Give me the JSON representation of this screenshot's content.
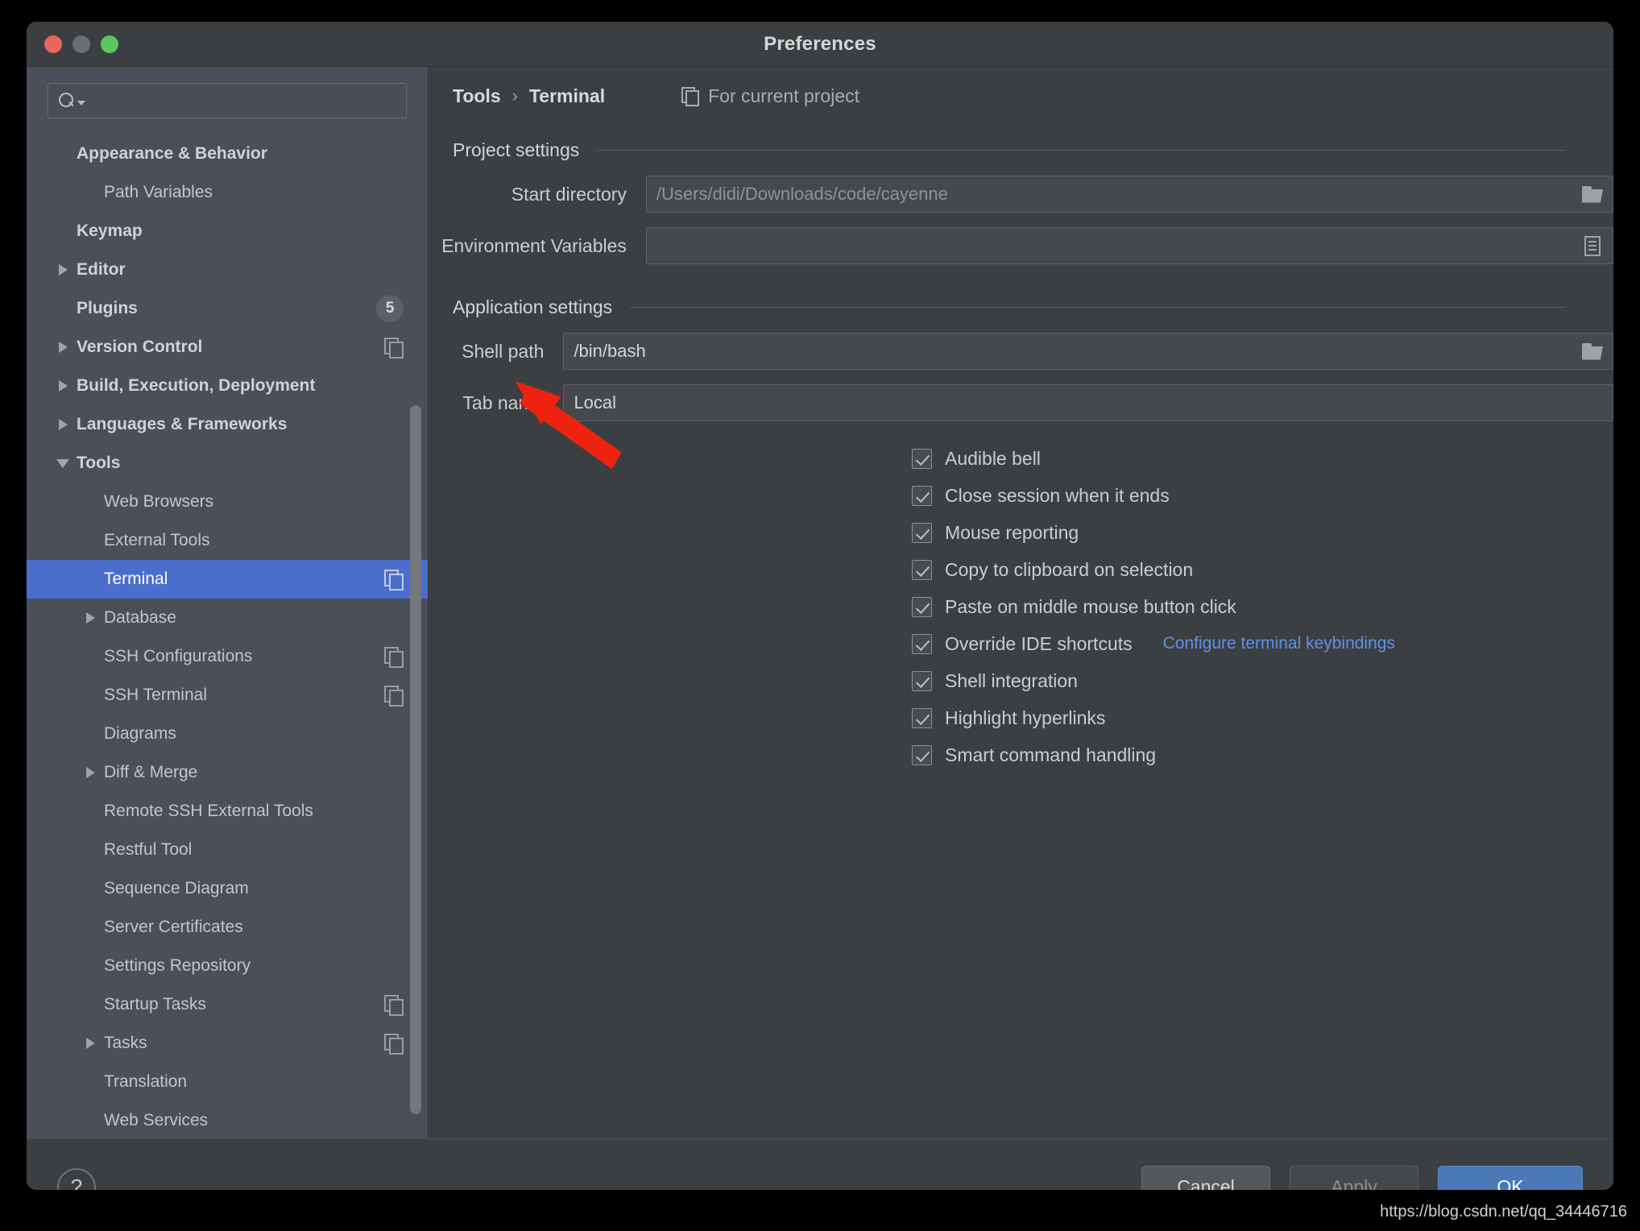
{
  "window": {
    "title": "Preferences",
    "traffic_lights": [
      "close",
      "minimize",
      "zoom"
    ]
  },
  "sidebar": {
    "search": {
      "value": "",
      "placeholder": ""
    },
    "items": [
      {
        "label": "Appearance & Behavior",
        "indent": 0,
        "bold": true,
        "arrow": "none"
      },
      {
        "label": "Path Variables",
        "indent": 1,
        "bold": false,
        "arrow": "none"
      },
      {
        "label": "Keymap",
        "indent": 0,
        "bold": true,
        "arrow": "none"
      },
      {
        "label": "Editor",
        "indent": 0,
        "bold": true,
        "arrow": "collapsed"
      },
      {
        "label": "Plugins",
        "indent": 0,
        "bold": true,
        "arrow": "none",
        "badge": "5"
      },
      {
        "label": "Version Control",
        "indent": 0,
        "bold": true,
        "arrow": "collapsed",
        "copy": true
      },
      {
        "label": "Build, Execution, Deployment",
        "indent": 0,
        "bold": true,
        "arrow": "collapsed"
      },
      {
        "label": "Languages & Frameworks",
        "indent": 0,
        "bold": true,
        "arrow": "collapsed"
      },
      {
        "label": "Tools",
        "indent": 0,
        "bold": true,
        "arrow": "expanded"
      },
      {
        "label": "Web Browsers",
        "indent": 1,
        "bold": false,
        "arrow": "none"
      },
      {
        "label": "External Tools",
        "indent": 1,
        "bold": false,
        "arrow": "none"
      },
      {
        "label": "Terminal",
        "indent": 1,
        "bold": false,
        "arrow": "none",
        "copy": true,
        "selected": true
      },
      {
        "label": "Database",
        "indent": 1,
        "bold": false,
        "arrow": "collapsed"
      },
      {
        "label": "SSH Configurations",
        "indent": 1,
        "bold": false,
        "arrow": "none",
        "copy": true
      },
      {
        "label": "SSH Terminal",
        "indent": 1,
        "bold": false,
        "arrow": "none",
        "copy": true
      },
      {
        "label": "Diagrams",
        "indent": 1,
        "bold": false,
        "arrow": "none"
      },
      {
        "label": "Diff & Merge",
        "indent": 1,
        "bold": false,
        "arrow": "collapsed"
      },
      {
        "label": "Remote SSH External Tools",
        "indent": 1,
        "bold": false,
        "arrow": "none"
      },
      {
        "label": "Restful Tool",
        "indent": 1,
        "bold": false,
        "arrow": "none"
      },
      {
        "label": "Sequence Diagram",
        "indent": 1,
        "bold": false,
        "arrow": "none"
      },
      {
        "label": "Server Certificates",
        "indent": 1,
        "bold": false,
        "arrow": "none"
      },
      {
        "label": "Settings Repository",
        "indent": 1,
        "bold": false,
        "arrow": "none"
      },
      {
        "label": "Startup Tasks",
        "indent": 1,
        "bold": false,
        "arrow": "none",
        "copy": true
      },
      {
        "label": "Tasks",
        "indent": 1,
        "bold": false,
        "arrow": "collapsed",
        "copy": true
      },
      {
        "label": "Translation",
        "indent": 1,
        "bold": false,
        "arrow": "none"
      },
      {
        "label": "Web Services",
        "indent": 1,
        "bold": false,
        "arrow": "none"
      }
    ]
  },
  "breadcrumb": {
    "root": "Tools",
    "separator": "›",
    "leaf": "Terminal",
    "scope": "For current project"
  },
  "project_settings": {
    "title": "Project settings",
    "start_directory": {
      "label": "Start directory",
      "value": "/Users/didi/Downloads/code/cayenne",
      "is_placeholder": true,
      "button_icon": "folder-open-icon"
    },
    "environment_variables": {
      "label": "Environment Variables",
      "value": "",
      "is_placeholder": true,
      "button_icon": "document-list-icon"
    }
  },
  "application_settings": {
    "title": "Application settings",
    "shell_path": {
      "label": "Shell path",
      "value": "/bin/bash",
      "is_placeholder": false,
      "button_icon": "folder-open-icon"
    },
    "tab_name": {
      "label": "Tab name",
      "value": "Local",
      "is_placeholder": false
    },
    "checkboxes": [
      {
        "label": "Audible bell",
        "checked": true
      },
      {
        "label": "Close session when it ends",
        "checked": true
      },
      {
        "label": "Mouse reporting",
        "checked": true
      },
      {
        "label": "Copy to clipboard on selection",
        "checked": true
      },
      {
        "label": "Paste on middle mouse button click",
        "checked": true
      },
      {
        "label": "Override IDE shortcuts",
        "checked": true,
        "link": "Configure terminal keybindings"
      },
      {
        "label": "Shell integration",
        "checked": true
      },
      {
        "label": "Highlight hyperlinks",
        "checked": true
      },
      {
        "label": "Smart command handling",
        "checked": true
      }
    ]
  },
  "footer": {
    "help_label": "?",
    "cancel_label": "Cancel",
    "apply_label": "Apply",
    "ok_label": "OK"
  },
  "annotation": {
    "type": "arrow",
    "color": "#ee2211",
    "points_at": "shell-path-field"
  },
  "watermark": "https://blog.csdn.net/qq_34446716",
  "colors": {
    "accent": "#4a6ecb",
    "link": "#5b93e8",
    "sidebar_bg": "#4a4f5a",
    "content_bg": "#3c3f41",
    "ok_button": "#4b79b8"
  }
}
